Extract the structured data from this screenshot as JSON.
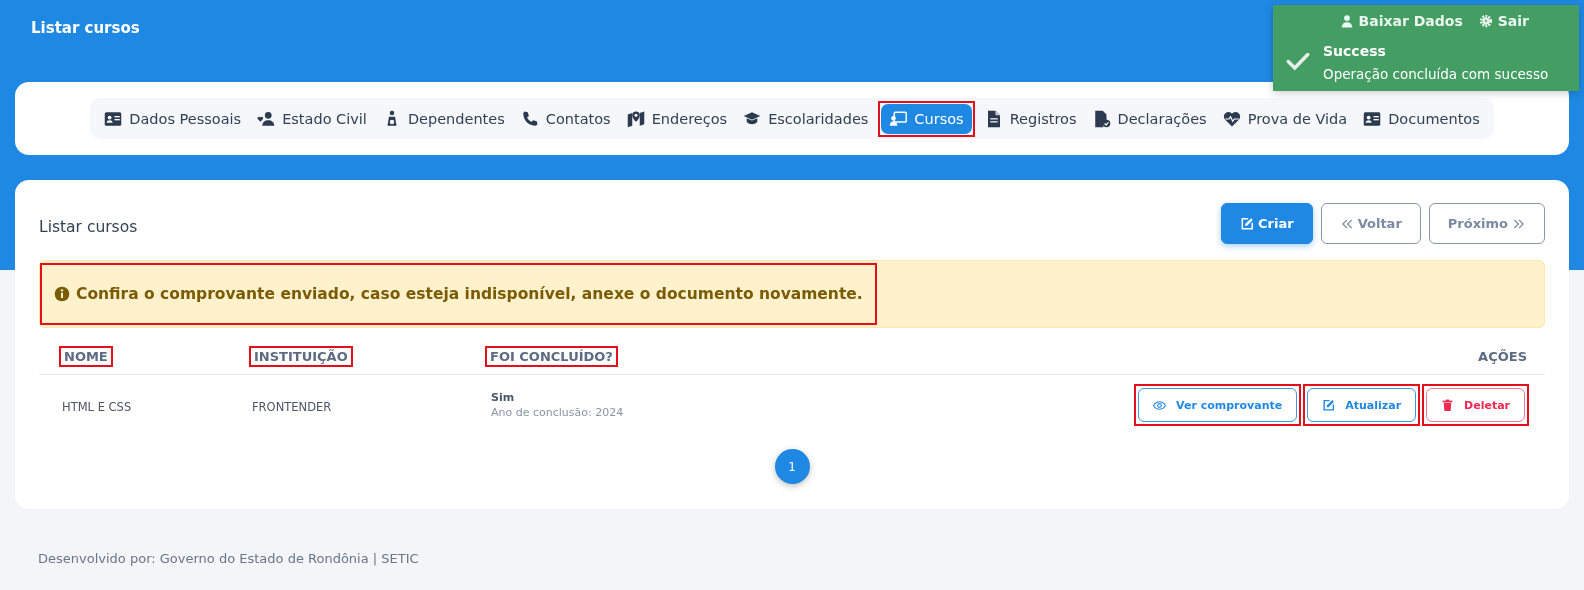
{
  "header": {
    "title": "Listar cursos",
    "links": [
      {
        "label": "Baixar Dados",
        "kind": "user"
      },
      {
        "label": "Sair",
        "kind": "gear"
      }
    ]
  },
  "toast": {
    "title": "Success",
    "message": "Operação concluída com sucesso"
  },
  "tabs": [
    {
      "label": "Dados Pessoais",
      "selected": false,
      "highlighted": false
    },
    {
      "label": "Estado Civil",
      "selected": false,
      "highlighted": false
    },
    {
      "label": "Dependentes",
      "selected": false,
      "highlighted": false
    },
    {
      "label": "Contatos",
      "selected": false,
      "highlighted": false
    },
    {
      "label": "Endereços",
      "selected": false,
      "highlighted": false
    },
    {
      "label": "Escolaridades",
      "selected": false,
      "highlighted": false
    },
    {
      "label": "Cursos",
      "selected": true,
      "highlighted": true
    },
    {
      "label": "Registros",
      "selected": false,
      "highlighted": false
    },
    {
      "label": "Declarações",
      "selected": false,
      "highlighted": false
    },
    {
      "label": "Prova de Vida",
      "selected": false,
      "highlighted": false
    },
    {
      "label": "Documentos",
      "selected": false,
      "highlighted": false
    }
  ],
  "panel": {
    "title": "Listar cursos",
    "buttons": [
      {
        "label": "Criar",
        "kind": "create"
      },
      {
        "label": "Voltar",
        "kind": "back"
      },
      {
        "label": "Próximo",
        "kind": "next"
      }
    ],
    "alert": {
      "text": "Confira o comprovante enviado, caso esteja indisponível, anexe o documento novamente.",
      "highlighted": true
    }
  },
  "table": {
    "columns": [
      {
        "label": "NOME",
        "highlighted": true
      },
      {
        "label": "INSTITUIÇÃO",
        "highlighted": true
      },
      {
        "label": "FOI CONCLUÍDO?",
        "highlighted": true
      },
      {
        "label": "AÇÕES",
        "highlighted": false
      }
    ],
    "rows": [
      {
        "name": "HTML E CSS",
        "institution": "FRONTENDER",
        "status": "Sim",
        "detail": "Ano de conclusão: 2024",
        "actions": [
          {
            "label": "Ver comprovante",
            "kind": "view",
            "highlighted": true
          },
          {
            "label": "Atualizar",
            "kind": "edit",
            "highlighted": true
          },
          {
            "label": "Deletar",
            "kind": "delete",
            "highlighted": true
          }
        ]
      }
    ]
  },
  "pagination": [
    {
      "label": "1",
      "selected": true
    }
  ],
  "footer": "Desenvolvido por: Governo do Estado de Rondônia | SETIC"
}
